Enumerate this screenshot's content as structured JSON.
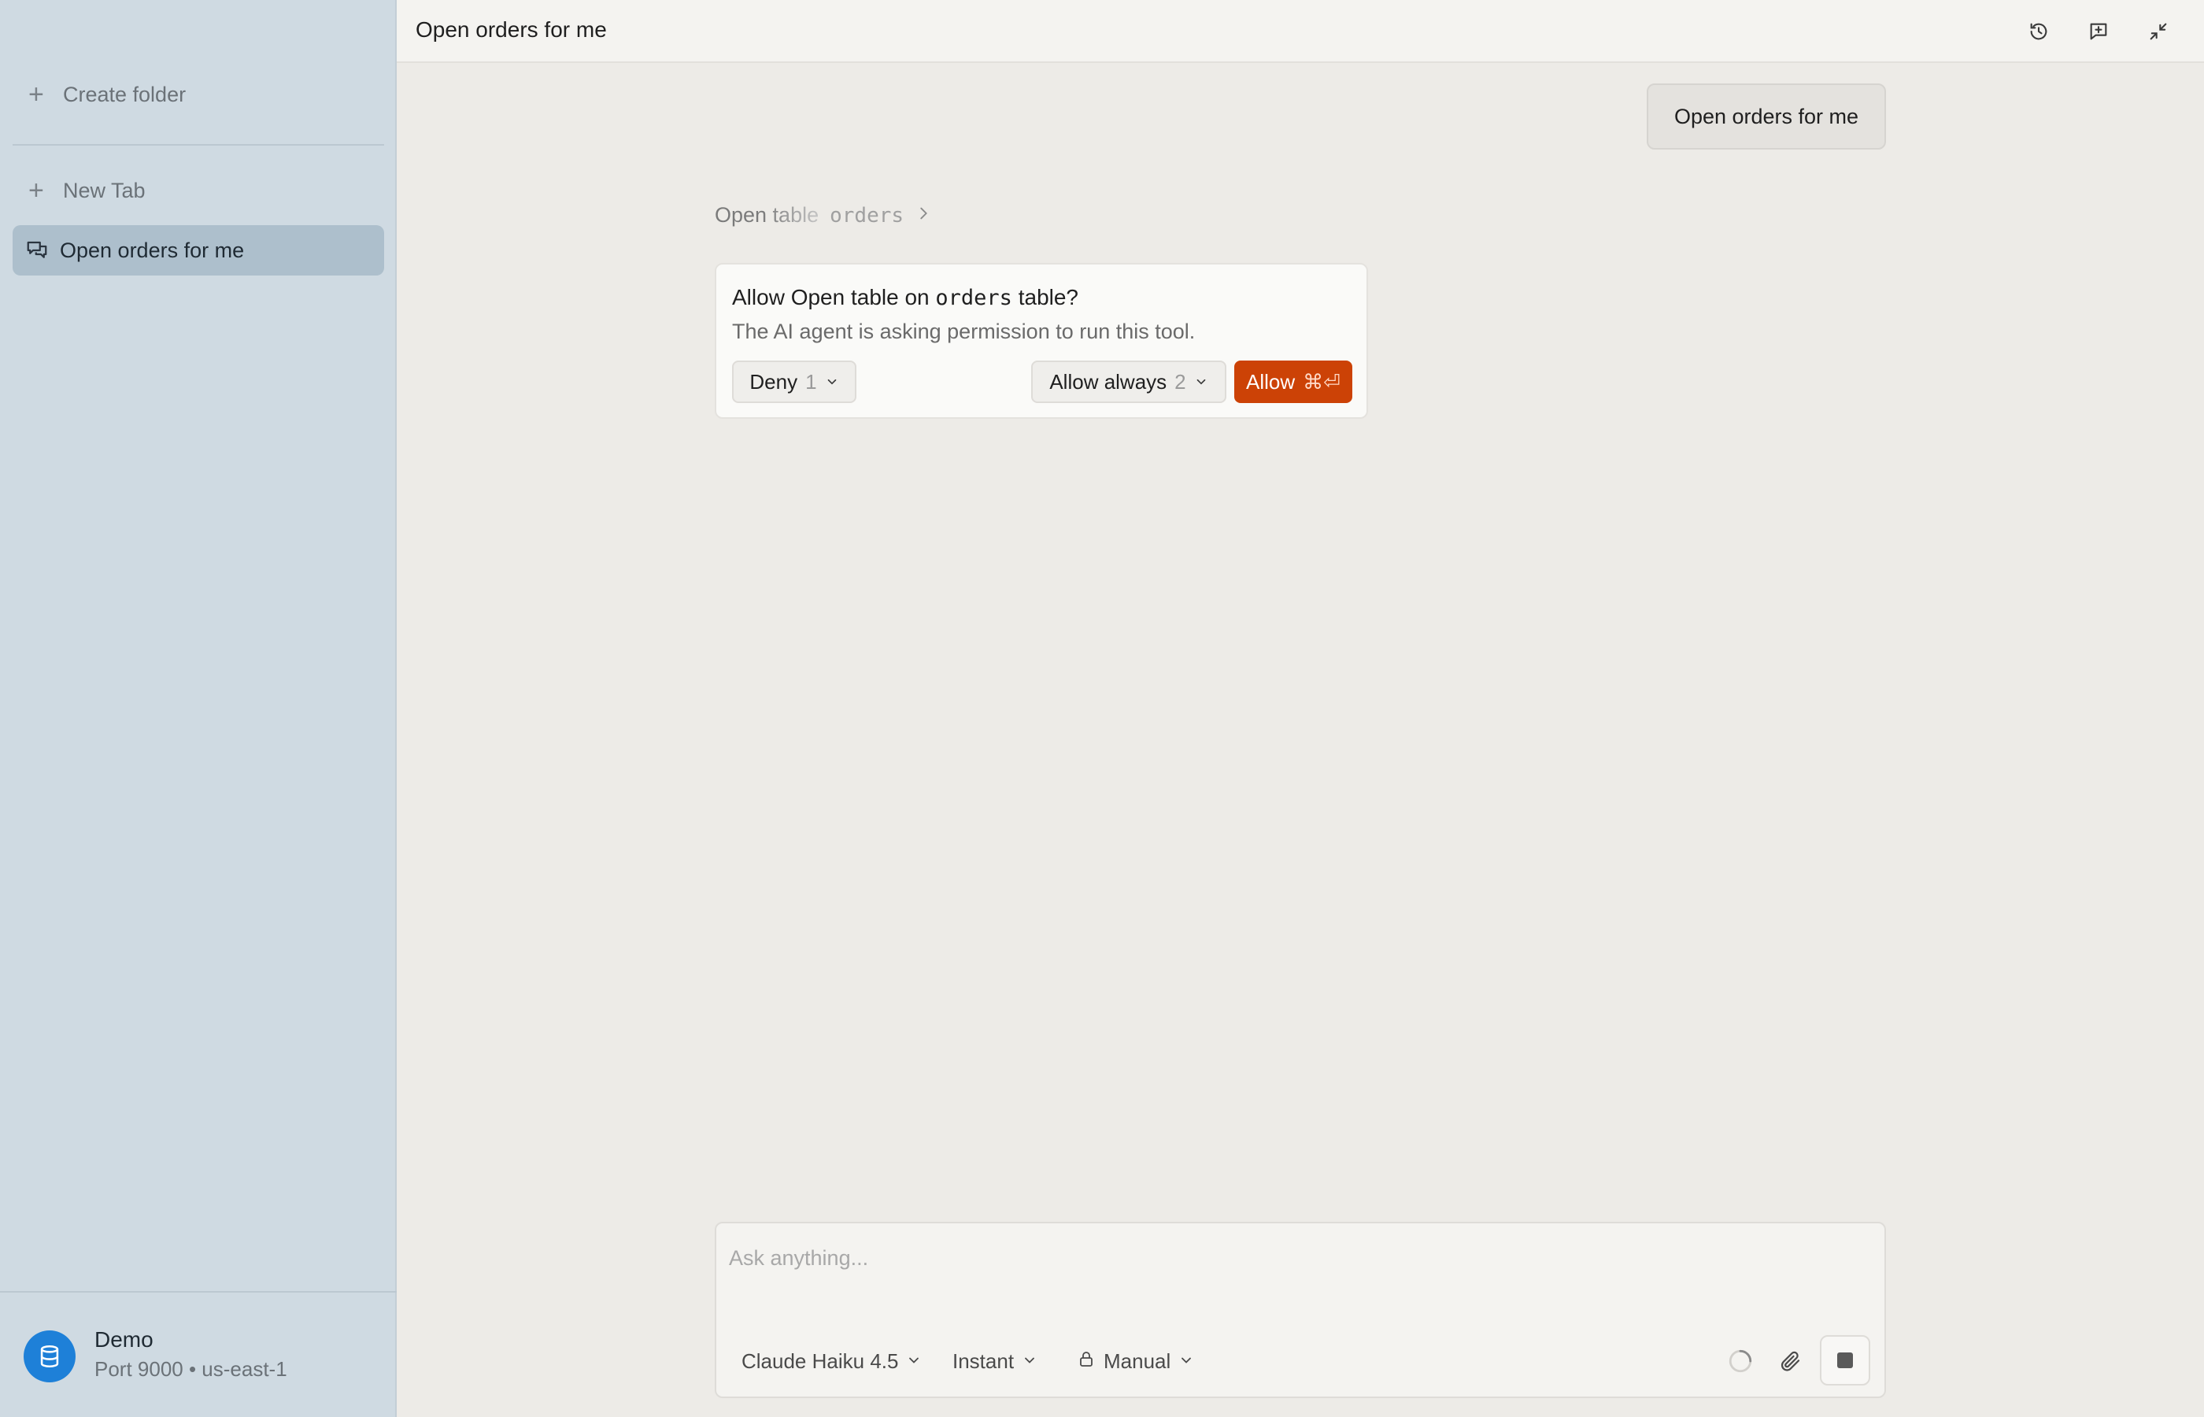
{
  "sidebar": {
    "create_folder": "Create folder",
    "new_tab": "New Tab",
    "active_item": "Open orders for me",
    "connection": {
      "name": "Demo",
      "meta": "Port 9000 • us-east-1"
    }
  },
  "header": {
    "title": "Open orders for me",
    "icons": [
      "history-icon",
      "new-chat-icon",
      "collapse-icon"
    ]
  },
  "chat": {
    "user_message": "Open orders for me",
    "tool_call": {
      "label": "Open table",
      "argument": "orders"
    },
    "permission": {
      "title_prefix": "Allow Open table on",
      "title_table": "orders",
      "title_suffix": "table?",
      "description": "The AI agent is asking permission to run this tool.",
      "deny_label": "Deny",
      "deny_hint": "1",
      "allow_always_label": "Allow always",
      "allow_always_hint": "2",
      "allow_label": "Allow",
      "allow_hint": "⌘⏎"
    }
  },
  "composer": {
    "placeholder": "Ask anything...",
    "model": "Claude Haiku 4.5",
    "speed": "Instant",
    "mode": "Manual"
  },
  "colors": {
    "sidebar_bg": "#cfdae2",
    "main_bg": "#edebe7",
    "accent": "#cc4206",
    "db_avatar": "#1e80d8"
  }
}
